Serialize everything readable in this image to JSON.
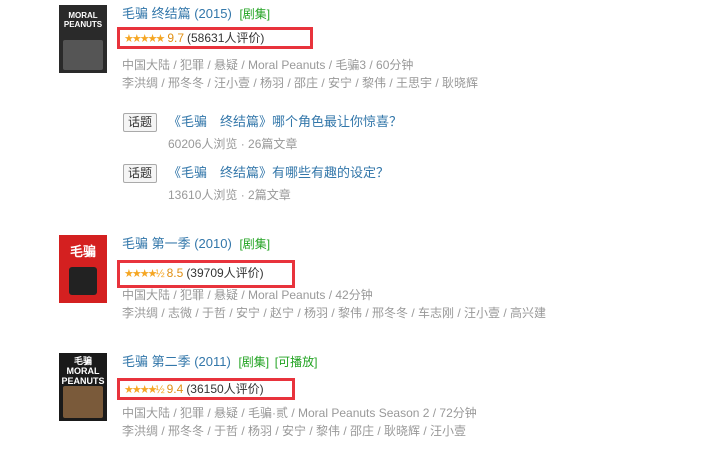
{
  "results": [
    {
      "title": "毛骗 终结篇 (2015)",
      "tags": [
        "[剧集]"
      ],
      "stars": "★★★★★",
      "score": "9.7",
      "count": "(58631人评价)",
      "meta1": "中国大陆 / 犯罪 / 悬疑 / Moral Peanuts / 毛骗3 / 60分钟",
      "meta2": "李洪绸 / 邢冬冬 / 汪小壹 / 杨羽 / 邵庄 / 安宁 / 黎伟 / 王思宇 / 耿晓辉",
      "poster_text": "MORAL PEANUTS",
      "topics": [
        {
          "btn": "话题",
          "title": "《毛骗　终结篇》哪个角色最让你惊喜？",
          "sub": "60206人浏览 · 26篇文章"
        },
        {
          "btn": "话题",
          "title": "《毛骗　终结篇》有哪些有趣的设定？",
          "sub": "13610人浏览 · 2篇文章"
        }
      ]
    },
    {
      "title": "毛骗 第一季 (2010)",
      "tags": [
        "[剧集]"
      ],
      "stars": "★★★★½",
      "score": "8.5",
      "count": "(39709人评价)",
      "meta1": "中国大陆 / 犯罪 / 悬疑 / Moral Peanuts / 42分钟",
      "meta2": "李洪绸 / 志微 / 于哲 / 安宁 / 赵宁 / 杨羽 / 黎伟 / 邢冬冬 / 车志刚 / 汪小壹 / 高兴建",
      "poster_text": "毛骗"
    },
    {
      "title": "毛骗 第二季 (2011)",
      "tags": [
        "[剧集]",
        "[可播放]"
      ],
      "stars": "★★★★½",
      "score": "9.4",
      "count": "(36150人评价)",
      "meta1": "中国大陆 / 犯罪 / 悬疑 / 毛骗·贰 / Moral Peanuts Season 2 / 72分钟",
      "meta2": "李洪绸 / 邢冬冬 / 于哲 / 杨羽 / 安宁 / 黎伟 / 邵庄 / 耿晓辉 / 汪小壹",
      "poster_text": "毛骗 MORAL PEANUTS"
    }
  ],
  "colors": {
    "link": "#3377aa",
    "tag": "#22a322",
    "highlight": "#e8333c",
    "star": "#f5a623"
  }
}
